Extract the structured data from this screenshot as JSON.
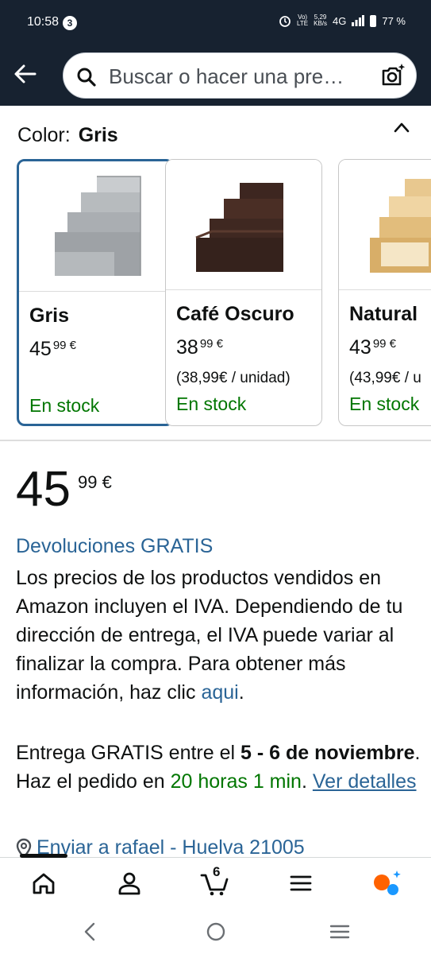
{
  "status": {
    "time": "10:58",
    "notif_count": "3",
    "volte_top": "Vo)",
    "volte_bottom": "LTE",
    "speed_top": "5,29",
    "speed_bottom": "KB/s",
    "network": "4G",
    "battery": "77 %"
  },
  "search": {
    "placeholder": "Buscar o hacer una pre…"
  },
  "color_selector": {
    "label": "Color:",
    "selected": "Gris",
    "options": [
      {
        "name": "Gris",
        "price_whole": "45",
        "price_fraction": "99 €",
        "unit_price": "",
        "stock": "En stock",
        "selected": true,
        "color": "#b8bcbf"
      },
      {
        "name": "Café Oscuro",
        "price_whole": "38",
        "price_fraction": "99 €",
        "unit_price": "(38,99€ / unidad)",
        "stock": "En stock",
        "selected": false,
        "color": "#3a2620"
      },
      {
        "name": "Natural",
        "price_whole": "43",
        "price_fraction": "99 €",
        "unit_price": "(43,99€ / u",
        "stock": "En stock",
        "selected": false,
        "color": "#e6c58d"
      }
    ]
  },
  "price": {
    "whole": "45",
    "fraction": "99 €"
  },
  "returns_label": "Devoluciones GRATIS",
  "vat_text": "Los precios de los productos vendidos en Amazon incluyen el IVA. Dependiendo de tu dirección de entrega, el IVA puede variar al finalizar la compra. Para obtener más información, haz clic ",
  "vat_link": "aqui",
  "vat_end": ".",
  "delivery": {
    "prefix": "Entrega GRATIS entre el ",
    "dates": "5 - 6 de noviembre",
    "middle": ". Haz el pedido en ",
    "time": "20 horas 1 min",
    "sep": ". ",
    "details_link": "Ver detalles"
  },
  "ship_to": "Enviar a rafael - Huelva 21005",
  "cart_count": "6",
  "colors": {
    "header_bg": "#172230",
    "link": "#2a6496",
    "stock_green": "#007600",
    "selected_border": "#2a6496"
  }
}
